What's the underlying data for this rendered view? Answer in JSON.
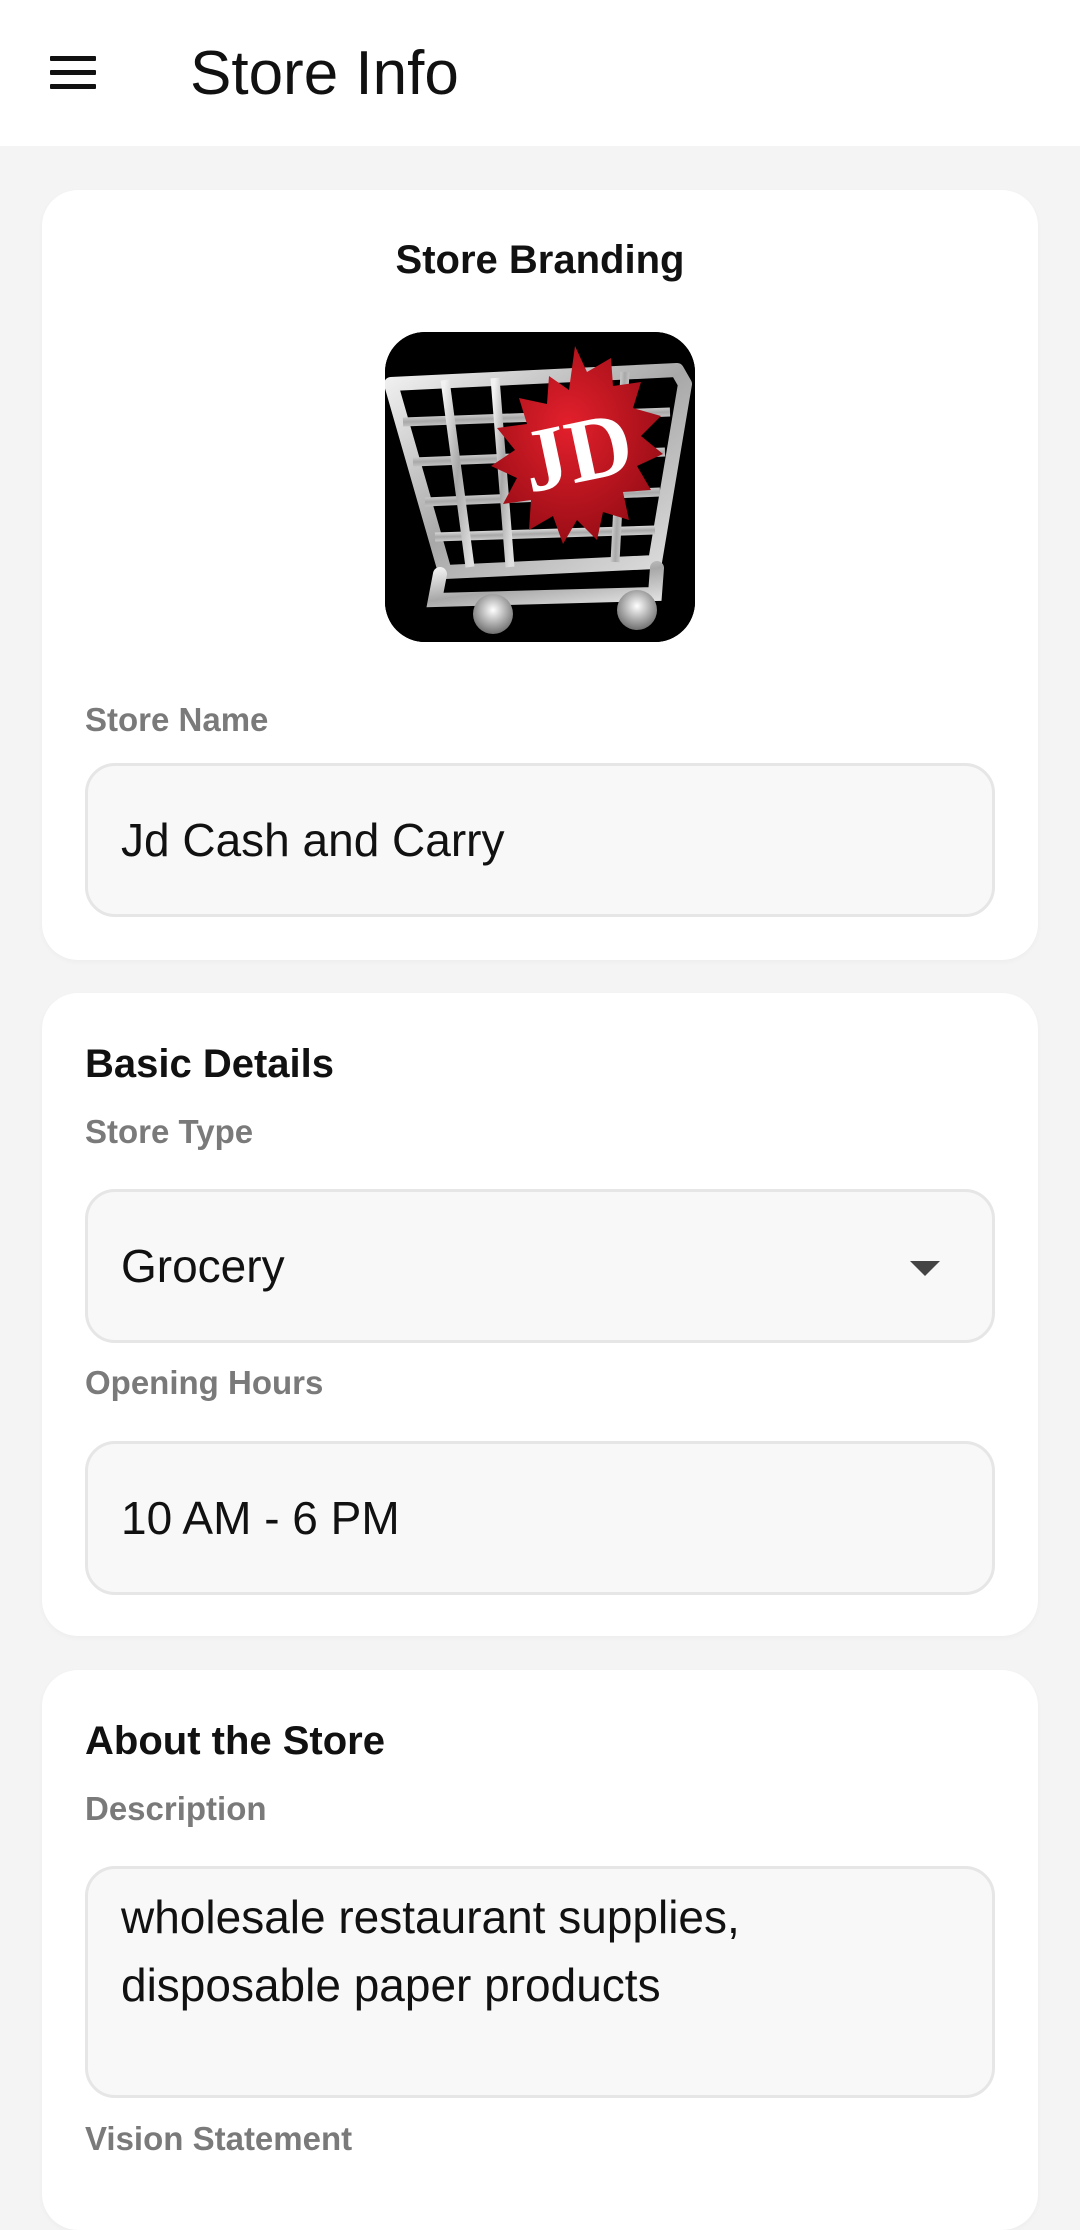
{
  "appbar": {
    "title": "Store Info",
    "menu_icon": "hamburger-menu-icon"
  },
  "branding": {
    "title": "Store Branding",
    "logo_text": "JD",
    "store_name_label": "Store Name",
    "store_name_value": "Jd Cash and Carry"
  },
  "basic": {
    "title": "Basic Details",
    "store_type_label": "Store Type",
    "store_type_value": "Grocery",
    "dropdown_icon": "dropdown-arrow-icon",
    "opening_hours_label": "Opening Hours",
    "opening_hours_value": "10 AM - 6 PM"
  },
  "about": {
    "title": "About the Store",
    "description_label": "Description",
    "description_value": "wholesale restaurant supplies, disposable paper products",
    "vision_label": "Vision Statement"
  },
  "colors": {
    "page_background": "#f4f4f4",
    "card_background": "#ffffff",
    "label_gray": "#7a7a7a",
    "field_background": "#f8f8f8",
    "logo_red": "#c8101c"
  }
}
